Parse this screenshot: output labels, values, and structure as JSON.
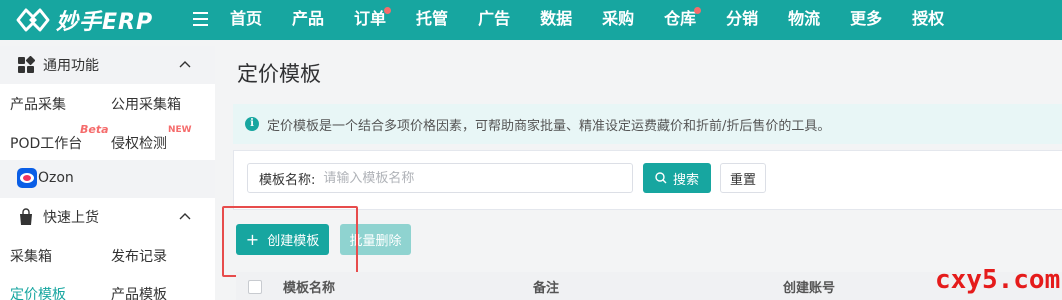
{
  "brand": {
    "name": "妙手ERP",
    "color": "#17a6a0"
  },
  "nav": {
    "items": [
      {
        "label": "首页",
        "dot": false
      },
      {
        "label": "产品",
        "dot": false
      },
      {
        "label": "订单",
        "dot": true
      },
      {
        "label": "托管",
        "dot": false
      },
      {
        "label": "广告",
        "dot": false
      },
      {
        "label": "数据",
        "dot": false
      },
      {
        "label": "采购",
        "dot": false
      },
      {
        "label": "仓库",
        "dot": true
      },
      {
        "label": "分销",
        "dot": false
      },
      {
        "label": "物流",
        "dot": false
      },
      {
        "label": "更多",
        "dot": false
      },
      {
        "label": "授权",
        "dot": false
      }
    ]
  },
  "sidebar": {
    "common": {
      "title": "通用功能",
      "links": [
        "产品采集",
        "公用采集箱",
        "POD工作台",
        "侵权检测"
      ],
      "beta_tag": "Beta",
      "new_tag": "NEW"
    },
    "platform": {
      "label": "Ozon"
    },
    "quick": {
      "title": "快速上货",
      "links": [
        "采集箱",
        "发布记录",
        "定价模板",
        "产品模板"
      ],
      "active": "定价模板"
    }
  },
  "main": {
    "title": "定价模板",
    "info": "定价模板是一个结合多项价格因素，可帮助商家批量、精准设定运费藏价和折前/折后售价的工具。",
    "search": {
      "label": "模板名称:",
      "placeholder": "请输入模板名称",
      "value": "",
      "search_btn": "搜索",
      "reset_btn": "重置"
    },
    "actions": {
      "create": "创建模板",
      "batch_delete": "批量删除"
    },
    "table": {
      "columns": [
        "模板名称",
        "备注",
        "创建账号"
      ]
    }
  },
  "watermark": "cxy5.com"
}
